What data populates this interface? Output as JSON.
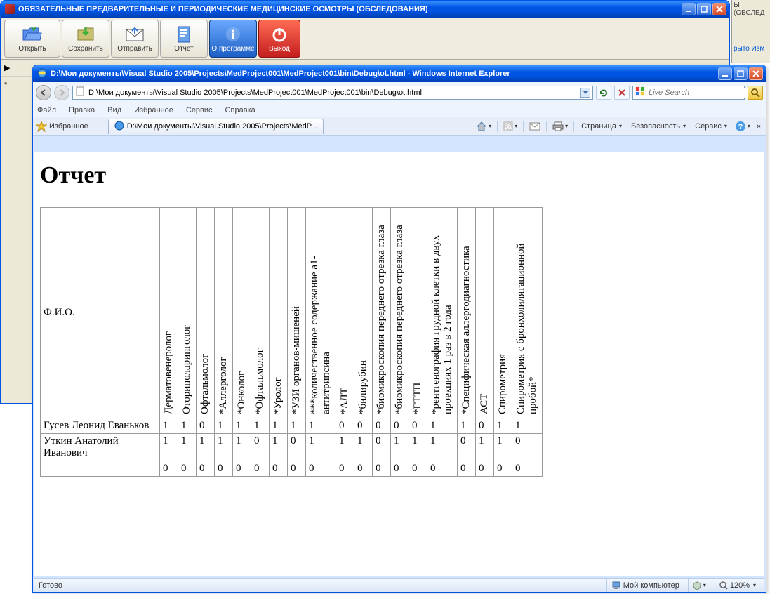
{
  "bg_peek": {
    "line1": "Ы (ОБСЛЕД",
    "line2": "рыто Изм"
  },
  "parent": {
    "title": "ОБЯЗАТЕЛЬНЫЕ ПРЕДВАРИТЕЛЬНЫЕ И ПЕРИОДИЧЕСКИЕ МЕДИЦИНСКИЕ ОСМОТРЫ (ОБСЛЕДОВАНИЯ)",
    "toolbar": {
      "open": "Открыть",
      "save": "Сохранить",
      "send": "Отправить",
      "report": "Отчет",
      "about": "О программе",
      "exit": "Выход"
    },
    "left_strip": {
      "item1": "▶",
      "item2": "*"
    }
  },
  "ie": {
    "title": "D:\\Мои документы\\Visual Studio 2005\\Projects\\MedProject001\\MedProject001\\bin\\Debug\\ot.html - Windows Internet Explorer",
    "address": "D:\\Мои документы\\Visual Studio 2005\\Projects\\MedProject001\\MedProject001\\bin\\Debug\\ot.html",
    "search_placeholder": "Live Search",
    "menu": {
      "file": "Файл",
      "edit": "Правка",
      "view": "Вид",
      "favorites": "Избранное",
      "tools": "Сервис",
      "help": "Справка"
    },
    "favorites_label": "Избранное",
    "tab_label": "D:\\Мои документы\\Visual Studio 2005\\Projects\\MedP...",
    "right_tb": {
      "page": "Страница",
      "security": "Безопасность",
      "tools": "Сервис"
    },
    "status": {
      "done": "Готово",
      "zone": "Мой компьютер",
      "zoom": "120%"
    }
  },
  "report": {
    "title": "Отчет",
    "first_col": "Ф.И.О.",
    "columns": [
      "Дерматовенеролог",
      "Оториноларинголог",
      "Офтальмолог",
      "*Аллерголог",
      "*Онколог",
      "*Офтальмолог",
      "*Уролог",
      "*УЗИ органов-мишеней",
      "***количественное содержание a1-антитрипсина",
      "*АЛТ",
      "*билирубин",
      "*биомикроскопия переднего отрезка глаза",
      "*биомикроскопия переднего отрезка глаза",
      "*ГТТП",
      "*рентгенография грудной клетки в двух проекциях 1 раз в 2 года",
      "*Специфическая аллергодиагностика",
      "АСТ",
      "Спирометрия",
      "Спирометрия с бронхолилятационной пробой*"
    ],
    "rows": [
      {
        "name": "Гусев Леонид Еваньков",
        "vals": [
          1,
          1,
          0,
          1,
          1,
          1,
          1,
          1,
          1,
          0,
          0,
          0,
          0,
          0,
          1,
          1,
          0,
          1,
          1
        ]
      },
      {
        "name": "Уткин Анатолий Иванович",
        "vals": [
          1,
          1,
          1,
          1,
          1,
          0,
          1,
          0,
          1,
          1,
          1,
          0,
          1,
          1,
          1,
          0,
          1,
          1,
          0
        ]
      },
      {
        "name": "",
        "vals": [
          0,
          0,
          0,
          0,
          0,
          0,
          0,
          0,
          0,
          0,
          0,
          0,
          0,
          0,
          0,
          0,
          0,
          0,
          0
        ]
      }
    ]
  }
}
